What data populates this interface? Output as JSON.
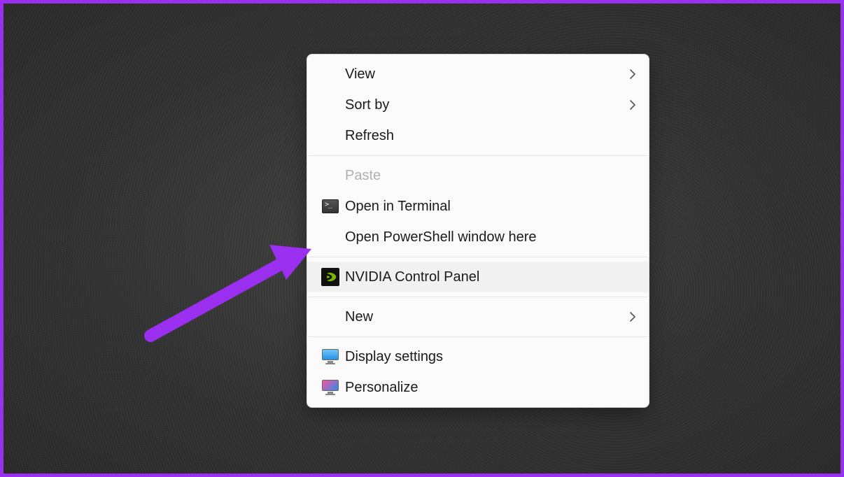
{
  "annotation": {
    "type": "arrow",
    "color": "#9a2ff0",
    "points_to": "nvidia-control-panel-item"
  },
  "menu": {
    "items": [
      {
        "label": "View",
        "has_submenu": true
      },
      {
        "label": "Sort by",
        "has_submenu": true
      },
      {
        "label": "Refresh"
      }
    ],
    "items2": [
      {
        "label": "Paste",
        "disabled": true
      },
      {
        "label": "Open in Terminal",
        "icon": "terminal-icon"
      },
      {
        "label": "Open PowerShell window here"
      }
    ],
    "items3": [
      {
        "label": "NVIDIA Control Panel",
        "icon": "nvidia-icon",
        "highlighted": true
      }
    ],
    "items4": [
      {
        "label": "New",
        "has_submenu": true
      }
    ],
    "items5": [
      {
        "label": "Display settings",
        "icon": "display-icon"
      },
      {
        "label": "Personalize",
        "icon": "personalize-icon"
      }
    ]
  }
}
